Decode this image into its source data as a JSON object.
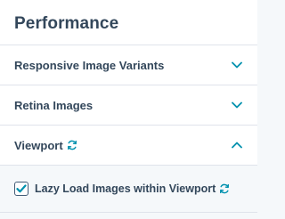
{
  "panel": {
    "title": "Performance"
  },
  "sections": [
    {
      "label": "Responsive Image Variants",
      "expanded": false
    },
    {
      "label": "Retina Images",
      "expanded": false
    },
    {
      "label": "Viewport",
      "expanded": true,
      "has_sync_icon": true
    }
  ],
  "viewport_section": {
    "checkbox_label": "Lazy Load Images within Viewport",
    "checked": true
  },
  "colors": {
    "text": "#33475b",
    "accent": "#0091ae",
    "border": "#dfe3eb",
    "panel_bg": "#f5f8fa"
  },
  "icons": {
    "collapsed": "chevron-down-icon",
    "expanded": "chevron-up-icon",
    "sync": "refresh-icon",
    "check": "checkmark-icon"
  }
}
